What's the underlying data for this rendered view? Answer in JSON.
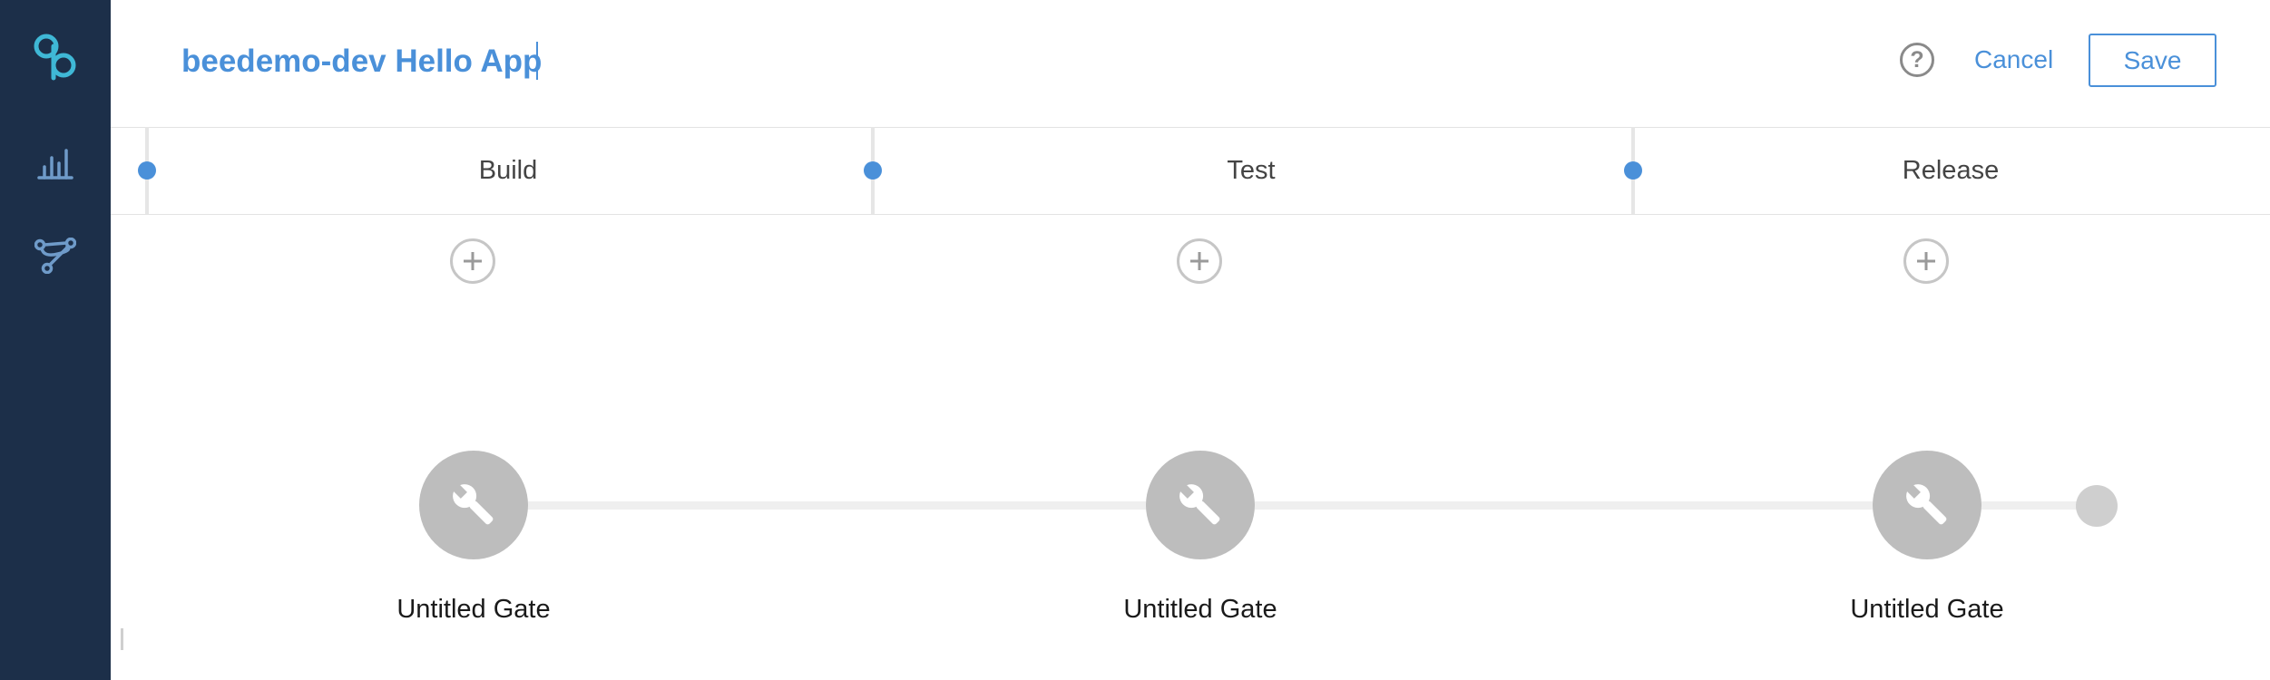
{
  "app": {
    "pipeline_title": "beedemo-dev Hello App"
  },
  "header": {
    "help_glyph": "?",
    "cancel_label": "Cancel",
    "save_label": "Save"
  },
  "sidebar": {
    "items": [
      {
        "icon": "logo-icon"
      },
      {
        "icon": "bar-chart-icon"
      },
      {
        "icon": "pipeline-icon"
      }
    ]
  },
  "phases": [
    {
      "label": "Build"
    },
    {
      "label": "Test"
    },
    {
      "label": "Release"
    }
  ],
  "gates": [
    {
      "label": "Untitled Gate",
      "icon": "wrench-icon"
    },
    {
      "label": "Untitled Gate",
      "icon": "wrench-icon"
    },
    {
      "label": "Untitled Gate",
      "icon": "wrench-icon"
    }
  ],
  "colors": {
    "sidebar_bg": "#1c2f49",
    "accent": "#4a90d9",
    "logo": "#3fb8d6",
    "gate": "#bdbdbd"
  }
}
